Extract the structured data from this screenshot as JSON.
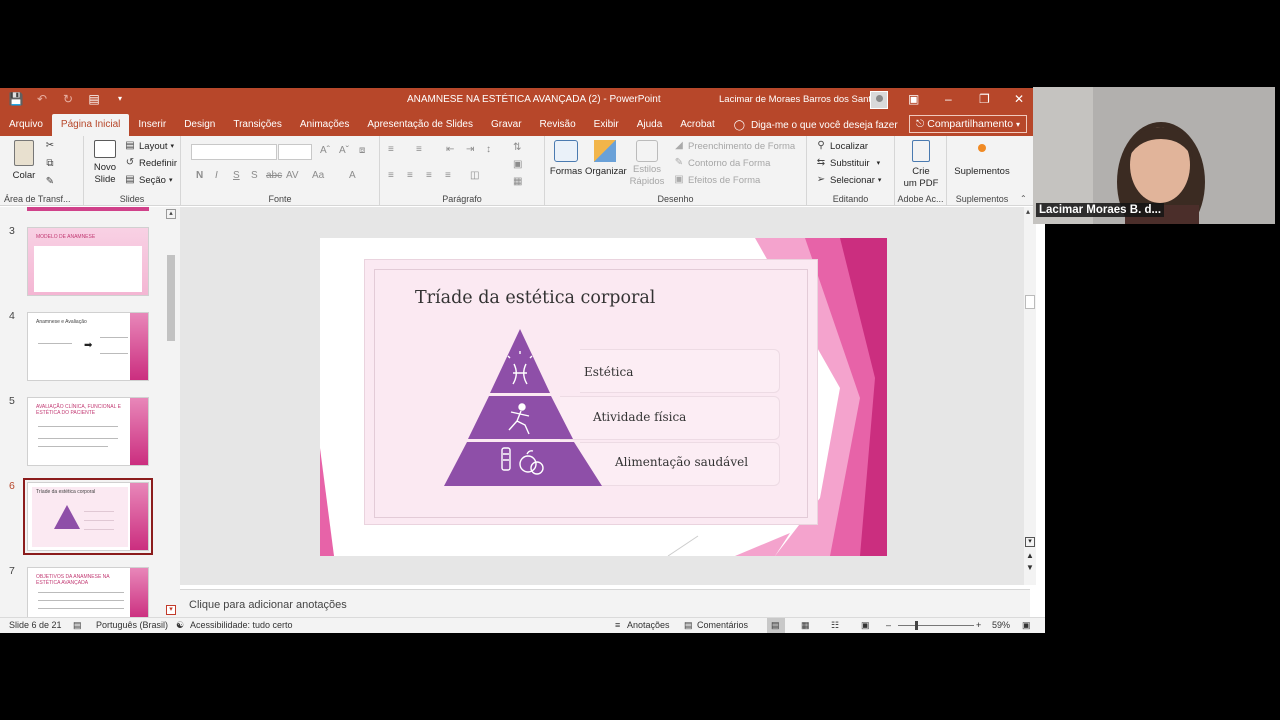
{
  "titlebar": {
    "title": "ANAMNESE NA ESTÉTICA AVANÇADA (2)  -  PowerPoint",
    "user": "Lacimar de Moraes Barros dos Santos"
  },
  "tabs": [
    "Arquivo",
    "Página Inicial",
    "Inserir",
    "Design",
    "Transições",
    "Animações",
    "Apresentação de Slides",
    "Gravar",
    "Revisão",
    "Exibir",
    "Ajuda",
    "Acrobat"
  ],
  "tell_me": "Diga-me o que você deseja fazer",
  "share": "Compartilhamento",
  "ribbon": {
    "clipboard": {
      "paste": "Colar",
      "label": "Área de Transf..."
    },
    "slides": {
      "new_slide_1": "Novo",
      "new_slide_2": "Slide",
      "layout": "Layout",
      "reset": "Redefinir",
      "section": "Seção",
      "label": "Slides"
    },
    "font": {
      "label": "Fonte",
      "bold": "N",
      "italic": "I",
      "underline": "S",
      "strike": "S",
      "spacing": "abc",
      "case": "Aa",
      "color": "A"
    },
    "paragraph": {
      "label": "Parágrafo"
    },
    "drawing": {
      "shapes": "Formas",
      "arrange": "Organizar",
      "styles_1": "Estilos",
      "styles_2": "Rápidos",
      "fill": "Preenchimento de Forma",
      "outline": "Contorno da Forma",
      "effects": "Efeitos de Forma",
      "label": "Desenho"
    },
    "editing": {
      "find": "Localizar",
      "replace": "Substituir",
      "select": "Selecionar",
      "label": "Editando"
    },
    "adobe": {
      "create_1": "Crie",
      "create_2": "um PDF",
      "label": "Adobe Ac..."
    },
    "addins": {
      "addins": "Suplementos",
      "label": "Suplementos"
    }
  },
  "thumbnails": [
    {
      "num": "3",
      "title": "MODELO DE ANAMNESE"
    },
    {
      "num": "4",
      "title": "Anamnese e Avaliação"
    },
    {
      "num": "5",
      "title": "AVALIAÇÃO CLÍNICA, FUNCIONAL E ESTÉTICA DO PACIENTE"
    },
    {
      "num": "6",
      "title": "Tríade da estética corporal"
    },
    {
      "num": "7",
      "title": "OBJETIVOS DA ANAMNESE NA ESTÉTICA AVANÇADA"
    }
  ],
  "slide": {
    "title": "Tríade da estética corporal",
    "levels": [
      "Estética",
      "Atividade física",
      "Alimentação saudável"
    ]
  },
  "notes_placeholder": "Clique para adicionar anotações",
  "status": {
    "slide_count": "Slide 6 de 21",
    "language": "Português (Brasil)",
    "accessibility": "Acessibilidade: tudo certo",
    "notes": "Anotações",
    "comments": "Comentários",
    "zoom": "59%"
  },
  "webcam": {
    "name": "Lacimar Moraes B. d..."
  },
  "colors": {
    "accent": "#b7472a",
    "pyramid": "#8e4fa8",
    "slide_pink": "#cb2e7f"
  }
}
